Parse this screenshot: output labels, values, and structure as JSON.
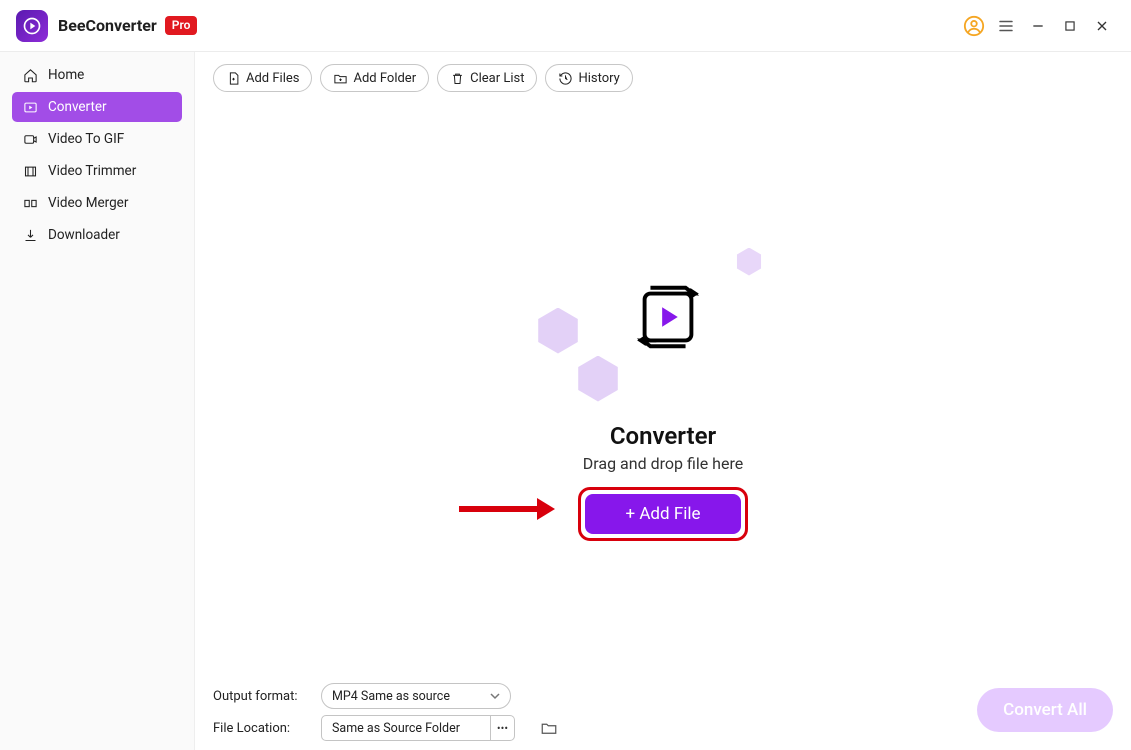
{
  "app": {
    "name": "BeeConverter",
    "badge": "Pro"
  },
  "sidebar": {
    "items": [
      {
        "label": "Home",
        "icon": "home-icon"
      },
      {
        "label": "Converter",
        "icon": "play-frame-icon",
        "active": true
      },
      {
        "label": "Video To GIF",
        "icon": "video-icon"
      },
      {
        "label": "Video Trimmer",
        "icon": "trim-icon"
      },
      {
        "label": "Video Merger",
        "icon": "merge-icon"
      },
      {
        "label": "Downloader",
        "icon": "download-icon"
      }
    ]
  },
  "toolbar": {
    "add_files": "Add Files",
    "add_folder": "Add Folder",
    "clear_list": "Clear List",
    "history": "History"
  },
  "center": {
    "title": "Converter",
    "subtitle": "Drag and drop file here",
    "button": "+ Add File"
  },
  "footer": {
    "output_format_label": "Output format:",
    "output_format_value": "MP4 Same as source",
    "file_location_label": "File Location:",
    "file_location_value": "Same as Source Folder",
    "convert_all": "Convert All"
  }
}
